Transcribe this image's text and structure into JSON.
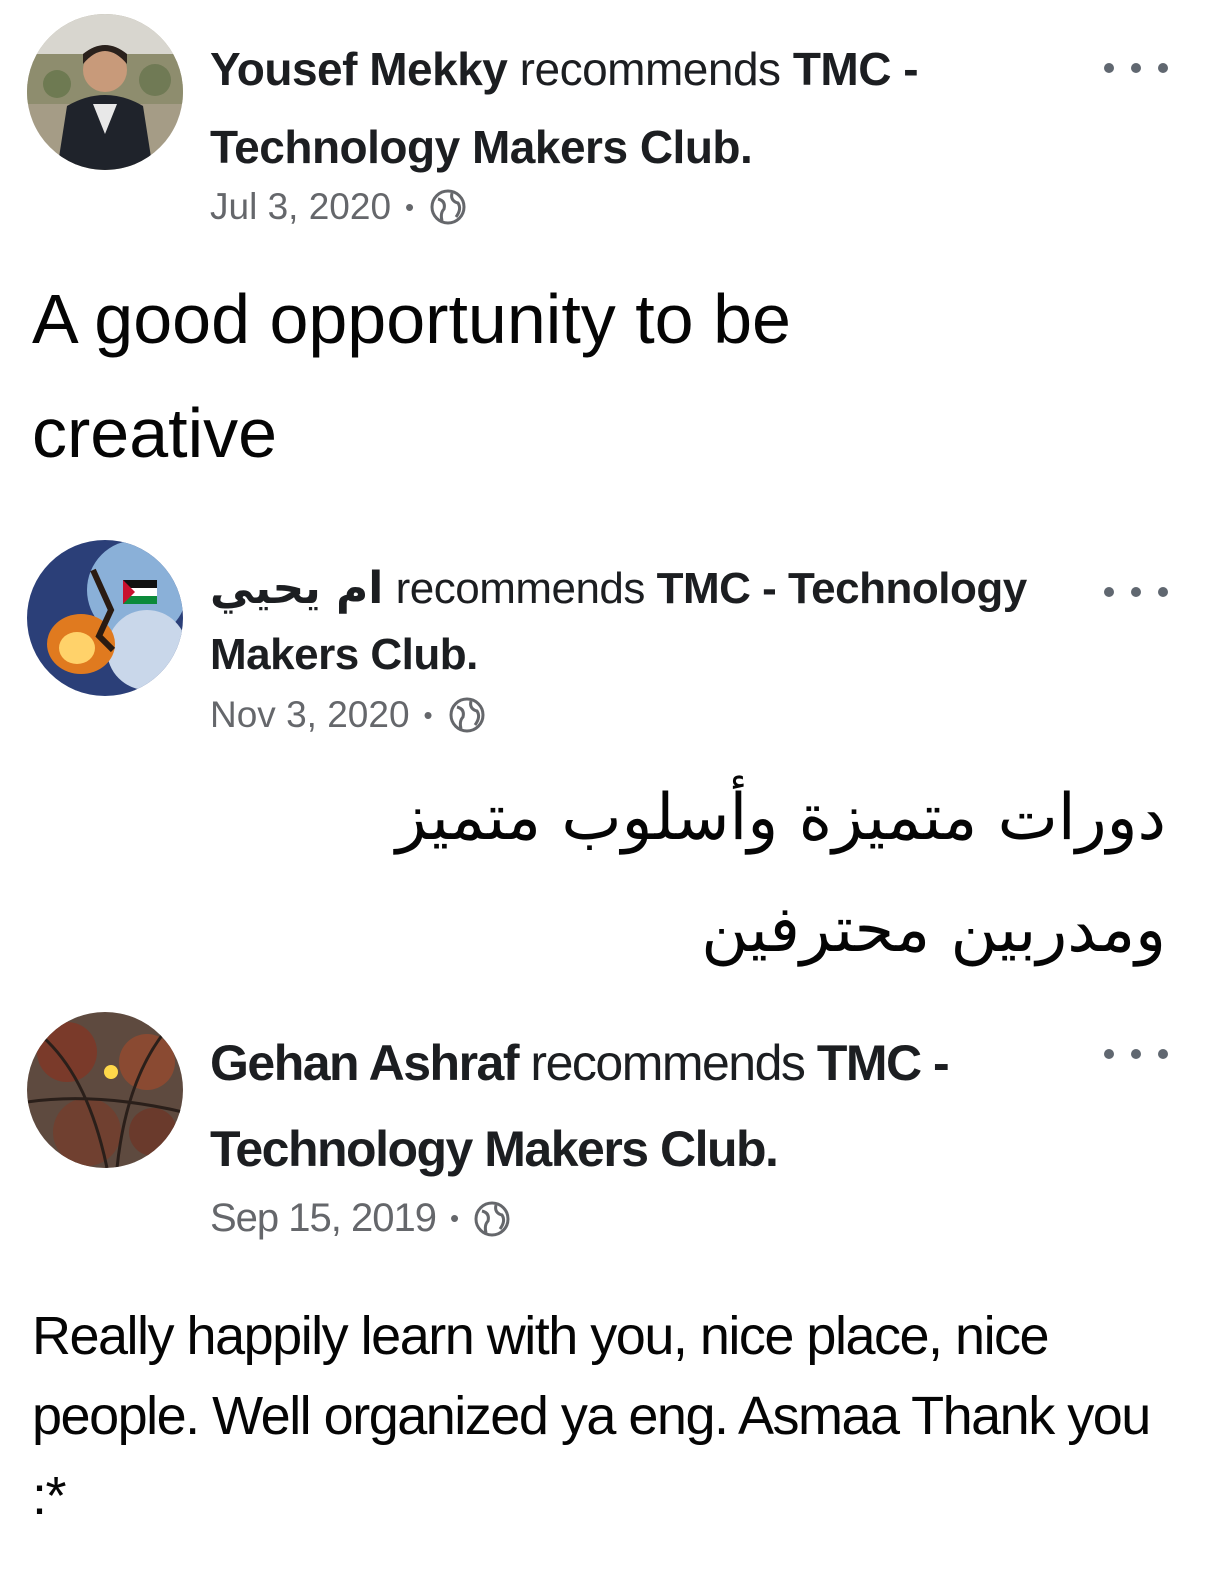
{
  "reviews": [
    {
      "author": "Yousef Mekky",
      "verb": "recommends",
      "page": "TMC - Technology Makers Club.",
      "date": "Jul 3, 2020",
      "separator": "•",
      "text": "A good opportunity to be creative",
      "audience_icon": "globe-icon"
    },
    {
      "author": "ام يحيي",
      "verb": "recommends",
      "page": "TMC - Technology Makers Club.",
      "date": "Nov 3, 2020",
      "separator": "•",
      "text": "دورات متميزة وأسلوب متميز ومدربين محترفين",
      "audience_icon": "globe-icon"
    },
    {
      "author": "Gehan Ashraf",
      "verb": "recommends",
      "page": "TMC - Technology Makers Club.",
      "date": "Sep 15, 2019",
      "separator": "•",
      "text": "Really happily learn with you, nice place, nice people. Well organized ya eng. Asmaa Thank you :*",
      "audience_icon": "globe-icon"
    }
  ],
  "more_icon": "more-options-icon"
}
